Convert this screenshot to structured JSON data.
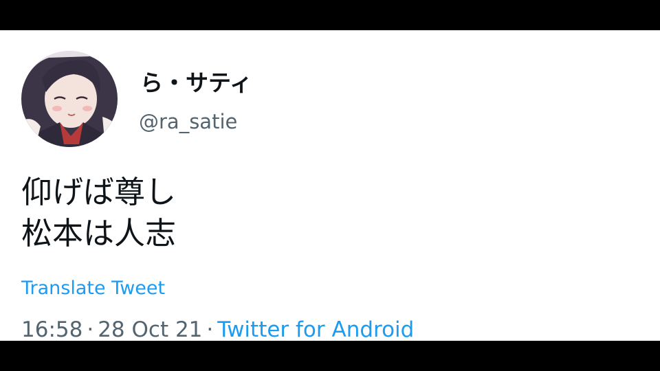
{
  "tweet": {
    "display_name": "ら・サティ",
    "handle": "@ra_satie",
    "text_lines": [
      "仰げば尊し",
      "松本は人志"
    ],
    "translate_label": "Translate Tweet",
    "time": "16:58",
    "date": "28 Oct 21",
    "separator": "·",
    "source": "Twitter for Android"
  },
  "icons": {
    "avatar": "profile-avatar"
  },
  "colors": {
    "link": "#1d9bf0",
    "secondary_text": "#536471",
    "primary_text": "#0f1419",
    "background": "#ffffff",
    "letterbox": "#000000"
  }
}
